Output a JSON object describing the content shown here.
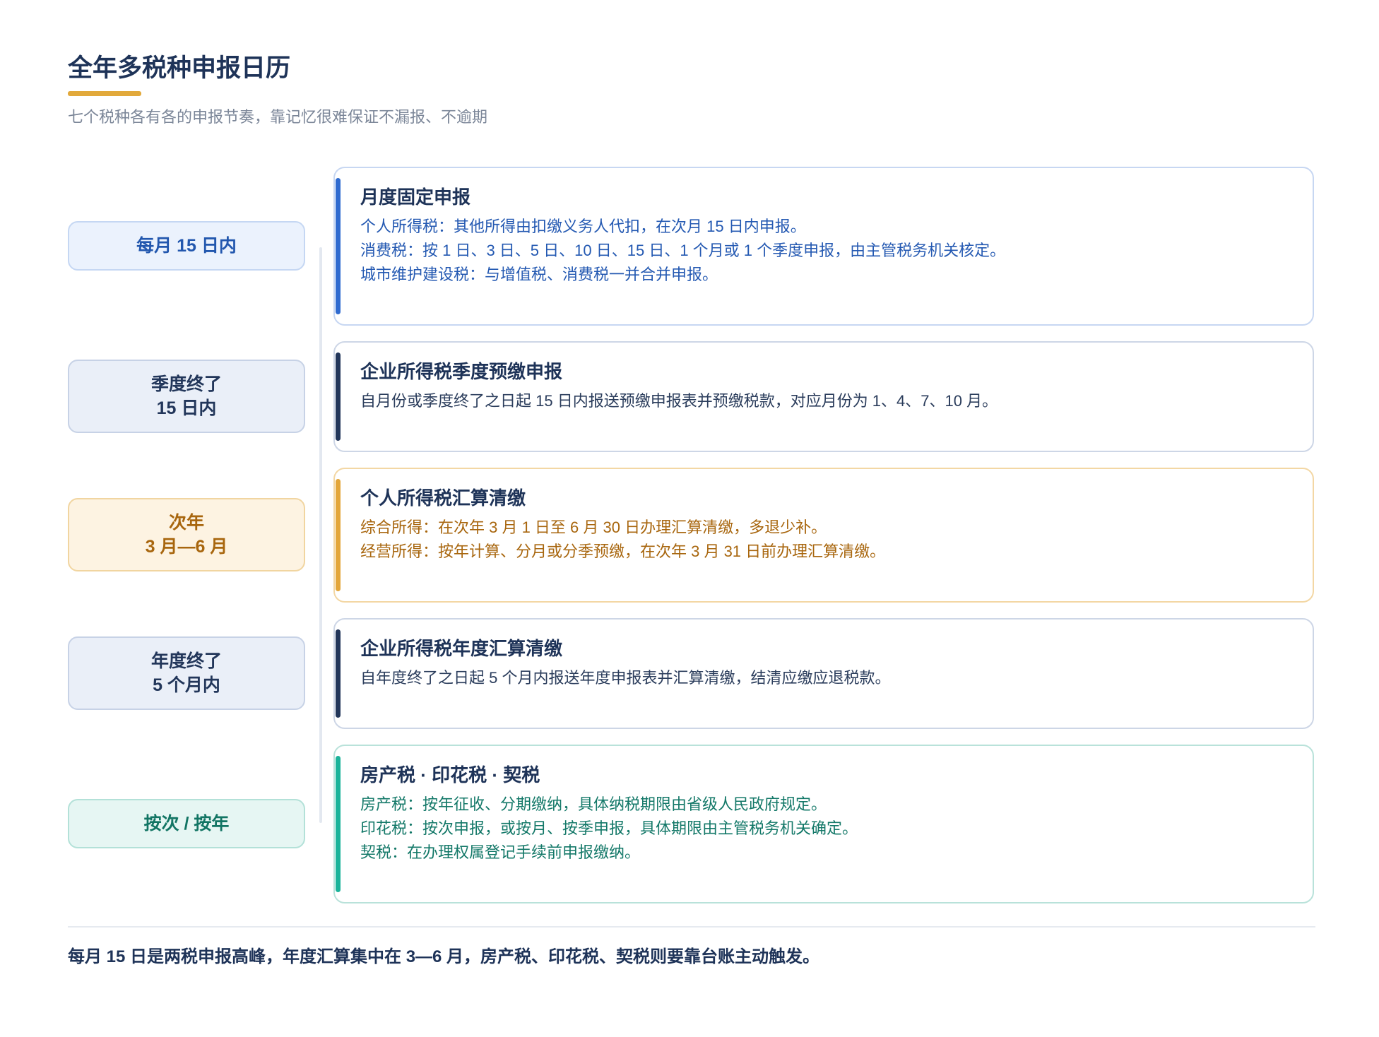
{
  "header": {
    "title": "全年多税种申报日历",
    "subtitle": "七个税种各有各的申报节奏，靠记忆很难保证不漏报、不逾期"
  },
  "timeline": [
    {
      "tag_lines": [
        "每月 15 日内"
      ],
      "title": "月度固定申报",
      "lines": [
        "个人所得税：其他所得由扣缴义务人代扣，在次月 15 日内申报。",
        "消费税：按 1 日、3 日、5 日、10 日、15 日、1 个月或 1 个季度申报，由主管税务机关核定。",
        "城市维护建设税：与增值税、消费税一并合并申报。"
      ]
    },
    {
      "tag_lines": [
        "季度终了",
        "15 日内"
      ],
      "title": "企业所得税季度预缴申报",
      "lines": [
        "自月份或季度终了之日起 15 日内报送预缴申报表并预缴税款，对应月份为 1、4、7、10 月。"
      ]
    },
    {
      "tag_lines": [
        "次年",
        "3 月—6 月"
      ],
      "title": "个人所得税汇算清缴",
      "lines": [
        "综合所得：在次年 3 月 1 日至 6 月 30 日办理汇算清缴，多退少补。",
        "经营所得：按年计算、分月或分季预缴，在次年 3 月 31 日前办理汇算清缴。"
      ]
    },
    {
      "tag_lines": [
        "年度终了",
        "5 个月内"
      ],
      "title": "企业所得税年度汇算清缴",
      "lines": [
        "自年度终了之日起 5 个月内报送年度申报表并汇算清缴，结清应缴应退税款。"
      ]
    },
    {
      "tag_lines": [
        "按次 / 按年"
      ],
      "title": "房产税 · 印花税 · 契税",
      "lines": [
        "房产税：按年征收、分期缴纳，具体纳税期限由省级人民政府规定。",
        "印花税：按次申报，或按月、按季申报，具体期限由主管税务机关确定。",
        "契税：在办理权属登记手续前申报缴纳。"
      ]
    }
  ],
  "footer": {
    "text": "每月 15 日是两税申报高峰，年度汇算集中在 3—6 月，房产税、印花税、契税则要靠台账主动触发。"
  },
  "colors": {
    "accent": "#e2a93b",
    "blue": "#2f6bd0",
    "navy": "#22365a",
    "amber": "#e3a63a",
    "teal": "#1bb39a"
  }
}
